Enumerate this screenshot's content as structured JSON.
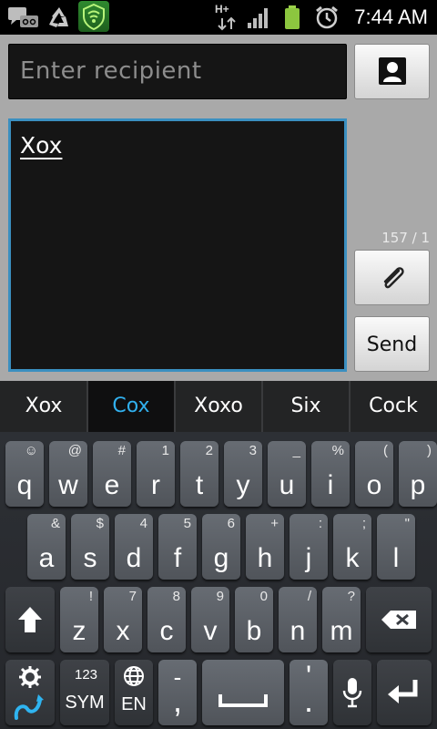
{
  "status_bar": {
    "time": "7:44 AM",
    "network": "H+",
    "icons": [
      "message-icon",
      "voicemail-icon",
      "recycle-icon",
      "shield-icon",
      "network-icon",
      "signal-icon",
      "battery-icon",
      "alarm-icon"
    ]
  },
  "compose": {
    "recipient_placeholder": "Enter recipient",
    "message_text": "Xox",
    "counter": "157 / 1",
    "send_label": "Send"
  },
  "suggestions": [
    "Xox",
    "Cox",
    "Xoxo",
    "Six",
    "Cock"
  ],
  "selected_suggestion": 1,
  "keyboard": {
    "row1": [
      {
        "k": "q",
        "s": "☺"
      },
      {
        "k": "w",
        "s": "@"
      },
      {
        "k": "e",
        "s": "#"
      },
      {
        "k": "r",
        "s": "1"
      },
      {
        "k": "t",
        "s": "2"
      },
      {
        "k": "y",
        "s": "3"
      },
      {
        "k": "u",
        "s": "_"
      },
      {
        "k": "i",
        "s": "%"
      },
      {
        "k": "o",
        "s": "("
      },
      {
        "k": "p",
        "s": ")"
      }
    ],
    "row2": [
      {
        "k": "a",
        "s": "&"
      },
      {
        "k": "s",
        "s": "$"
      },
      {
        "k": "d",
        "s": "4"
      },
      {
        "k": "f",
        "s": "5"
      },
      {
        "k": "g",
        "s": "6"
      },
      {
        "k": "h",
        "s": "+"
      },
      {
        "k": "j",
        "s": ":"
      },
      {
        "k": "k",
        "s": ";"
      },
      {
        "k": "l",
        "s": "\""
      }
    ],
    "row3": [
      {
        "k": "z",
        "s": "!"
      },
      {
        "k": "x",
        "s": "7"
      },
      {
        "k": "c",
        "s": "8"
      },
      {
        "k": "v",
        "s": "9"
      },
      {
        "k": "b",
        "s": "0"
      },
      {
        "k": "n",
        "s": "/"
      },
      {
        "k": "m",
        "s": "?"
      }
    ],
    "sym_num": "123",
    "sym_label": "SYM",
    "lang_label": "EN",
    "comma_top": "-",
    "comma_main": ",",
    "period_top": "'",
    "period_main": "."
  },
  "colors": {
    "accent": "#31b0ee",
    "field_border": "#3a8fc0",
    "compose_bg": "#a9a9a9",
    "key_bg": "#5c6066"
  }
}
